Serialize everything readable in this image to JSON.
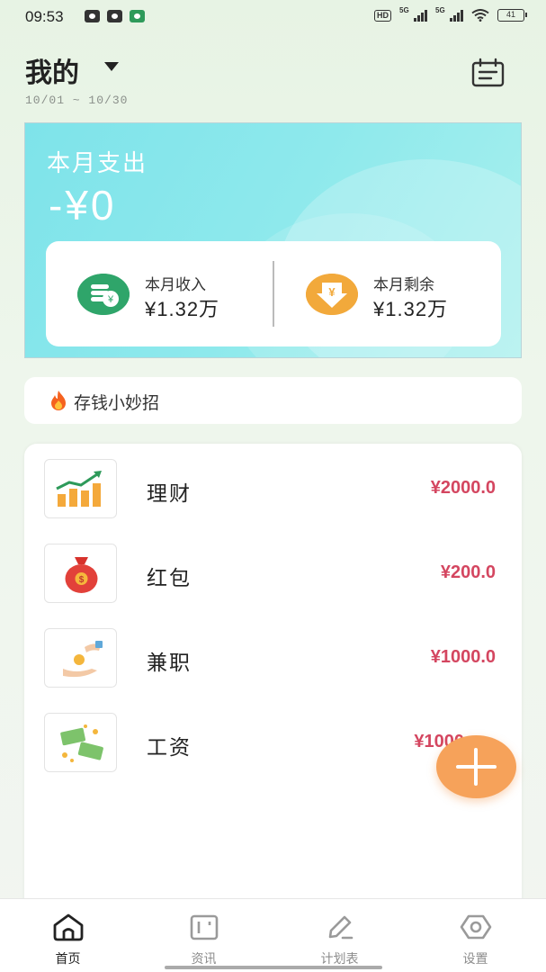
{
  "status_bar": {
    "time": "09:53",
    "hd_badge": "HD",
    "signal1_label": "5G",
    "signal2_label": "5G",
    "battery": "41"
  },
  "header": {
    "title": "我的",
    "date_range": "10/01 ~ 10/30"
  },
  "expense_card": {
    "label": "本月支出",
    "value": "-¥0",
    "income_label": "本月收入",
    "income_value": "¥1.32万",
    "balance_label": "本月剩余",
    "balance_value": "¥1.32万"
  },
  "tips": {
    "text": "存钱小妙招"
  },
  "income_items": [
    {
      "name": "理财",
      "amount": "¥2000.0",
      "icon": "investment-chart-icon"
    },
    {
      "name": "红包",
      "amount": "¥200.0",
      "icon": "money-bag-icon"
    },
    {
      "name": "兼职",
      "amount": "¥1000.0",
      "icon": "hand-coin-icon"
    },
    {
      "name": "工资",
      "amount": "¥1000",
      "icon": "cash-bills-icon"
    }
  ],
  "tab_bar": {
    "tabs": [
      {
        "label": "首页",
        "icon": "home-icon",
        "active": true
      },
      {
        "label": "资讯",
        "icon": "news-icon",
        "active": false
      },
      {
        "label": "计划表",
        "icon": "pencil-icon",
        "active": false
      },
      {
        "label": "设置",
        "icon": "eye-icon",
        "active": false
      }
    ]
  },
  "colors": {
    "accent_green": "#2fa56a",
    "amount_red": "#d44660",
    "fab_orange": "#f6a25a",
    "card_cyan": "#8ee9ec"
  }
}
